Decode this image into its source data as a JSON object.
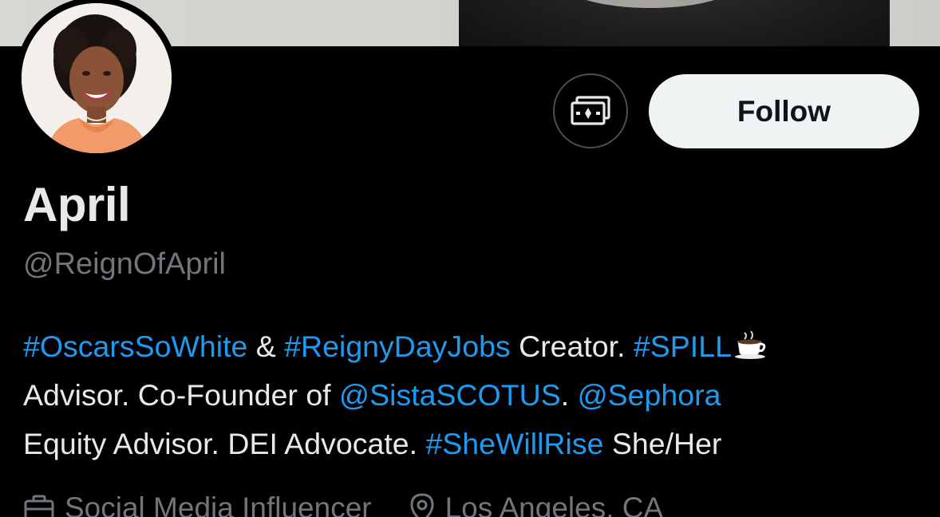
{
  "theme": {
    "background": "#000000",
    "text_primary": "#e7e9ea",
    "text_secondary": "#71767b",
    "link": "#1d9bf0",
    "follow_button_bg": "#eff3f4",
    "follow_button_text": "#0f1419"
  },
  "profile": {
    "name": "April",
    "handle": "@ReignOfApril",
    "avatar_icon": "avatar-photo",
    "actions": {
      "tip_icon": "money-icon",
      "follow_label": "Follow"
    }
  },
  "bio": {
    "lines": [
      [
        {
          "text": "#OscarsSoWhite",
          "link": true
        },
        {
          "text": " & ",
          "link": false
        },
        {
          "text": "#ReignyDayJobs",
          "link": true
        },
        {
          "text": " Creator. ",
          "link": false
        },
        {
          "text": "#SPILL",
          "link": true
        },
        {
          "text": "☕",
          "emoji": true
        }
      ],
      [
        {
          "text": "Advisor. Co-Founder of ",
          "link": false
        },
        {
          "text": "@SistaSCOTUS",
          "link": true
        },
        {
          "text": ". ",
          "link": false
        },
        {
          "text": "@Sephora",
          "link": true
        }
      ],
      [
        {
          "text": "Equity Advisor. DEI Advocate. ",
          "link": false
        },
        {
          "text": "#SheWillRise",
          "link": true
        },
        {
          "text": " She/Her",
          "link": false
        }
      ]
    ]
  },
  "meta": {
    "category_icon": "briefcase-icon",
    "category": "Social Media Influencer",
    "location_icon": "location-pin-icon",
    "location": "Los Angeles, CA"
  }
}
